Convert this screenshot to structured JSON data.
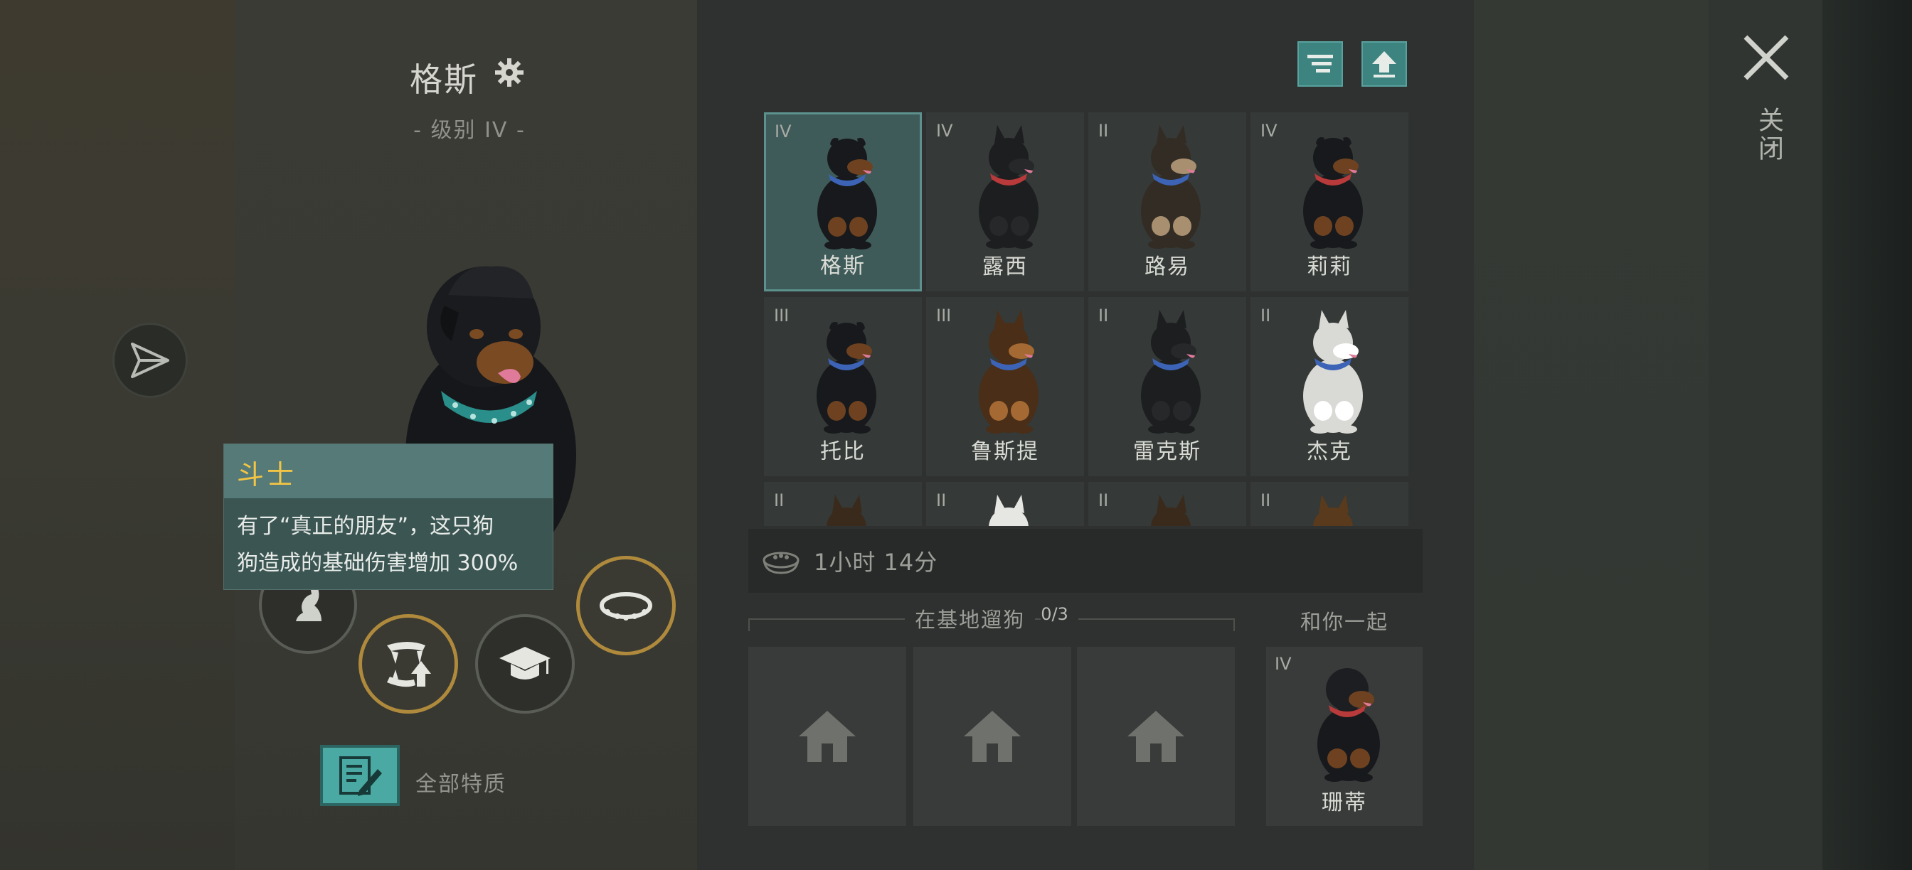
{
  "dog": {
    "name": "格斯",
    "level": "- 级别 IV -"
  },
  "tooltip": {
    "title": "斗士",
    "line1": "有了“真正的朋友”，这只狗",
    "line2": "狗造成的基础伤害增加 300%"
  },
  "traits": {
    "label": "全部特质"
  },
  "grid": [
    {
      "level": "IV",
      "name": "格斯",
      "selected": true
    },
    {
      "level": "IV",
      "name": "露西"
    },
    {
      "level": "II",
      "name": "路易"
    },
    {
      "level": "IV",
      "name": "莉莉"
    },
    {
      "level": "III",
      "name": "托比"
    },
    {
      "level": "III",
      "name": "鲁斯提"
    },
    {
      "level": "II",
      "name": "雷克斯"
    },
    {
      "level": "II",
      "name": "杰克"
    },
    {
      "level": "II",
      "name": ""
    },
    {
      "level": "II",
      "name": ""
    },
    {
      "level": "II",
      "name": ""
    },
    {
      "level": "II",
      "name": ""
    }
  ],
  "food": {
    "time": "1小时 14分"
  },
  "walk": {
    "title": "在基地遛狗",
    "count": "0/3"
  },
  "with_you": {
    "title": "和你一起",
    "level": "IV",
    "name": "珊蒂"
  },
  "close": {
    "label": "关闭"
  },
  "colors": {
    "accent": "#3d8481",
    "gold": "#b08a3c",
    "tooltip_title": "#f3c544"
  }
}
